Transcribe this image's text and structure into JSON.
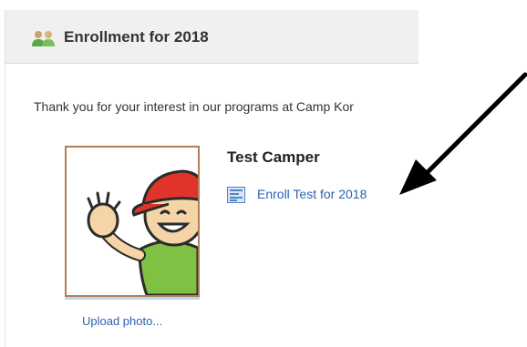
{
  "panel": {
    "title": "Enrollment for 2018",
    "header_icon": "users-icon"
  },
  "intro_text": "Thank you for your interest in our programs at Camp Kor",
  "camper": {
    "name": "Test Camper",
    "enroll_link": "Enroll Test for 2018",
    "enroll_icon": "form-document-icon",
    "upload_photo": "Upload photo...",
    "photo": "cartoon-camper-avatar"
  },
  "colors": {
    "link": "#2a62b5",
    "header_bg": "#f0f0f0",
    "photo_border": "#b57d55",
    "annotation_arrow": "#000000"
  }
}
